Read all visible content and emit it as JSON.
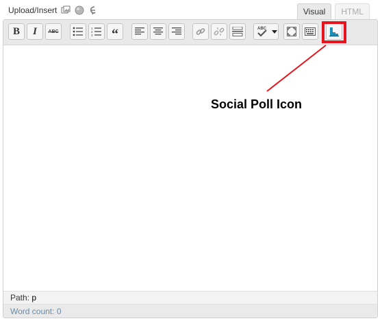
{
  "header": {
    "upload_label": "Upload/Insert",
    "upload_icons": [
      "add-image-icon",
      "add-media-icon",
      "add-audio-icon"
    ]
  },
  "tabs": [
    {
      "label": "Visual",
      "active": true
    },
    {
      "label": "HTML",
      "active": false
    }
  ],
  "toolbar": {
    "buttons": [
      {
        "name": "bold-button",
        "icon": "bold-icon",
        "glyph": "B"
      },
      {
        "name": "italic-button",
        "icon": "italic-icon",
        "glyph": "I"
      },
      {
        "name": "strikethrough-button",
        "icon": "strikethrough-icon",
        "glyph": "ABC"
      },
      {
        "name": "bulleted-list-button",
        "icon": "bulleted-list-icon"
      },
      {
        "name": "numbered-list-button",
        "icon": "numbered-list-icon"
      },
      {
        "name": "blockquote-button",
        "icon": "blockquote-icon",
        "glyph": "“"
      },
      {
        "name": "align-left-button",
        "icon": "align-left-icon"
      },
      {
        "name": "align-center-button",
        "icon": "align-center-icon"
      },
      {
        "name": "align-right-button",
        "icon": "align-right-icon"
      },
      {
        "name": "insert-link-button",
        "icon": "link-icon"
      },
      {
        "name": "unlink-button",
        "icon": "unlink-icon"
      },
      {
        "name": "more-tag-button",
        "icon": "more-tag-icon"
      },
      {
        "name": "spellcheck-button",
        "icon": "spellcheck-icon",
        "glyph": "ABC"
      },
      {
        "name": "fullscreen-button",
        "icon": "fullscreen-icon"
      },
      {
        "name": "kitchen-sink-button",
        "icon": "kitchen-sink-icon"
      },
      {
        "name": "social-poll-button",
        "icon": "social-poll-icon"
      }
    ]
  },
  "annotation": {
    "label": "Social Poll Icon",
    "color": "#e8131d"
  },
  "status": {
    "path_label": "Path:",
    "path_value": "p",
    "word_count_label": "Word count:",
    "word_count_value": "0"
  }
}
